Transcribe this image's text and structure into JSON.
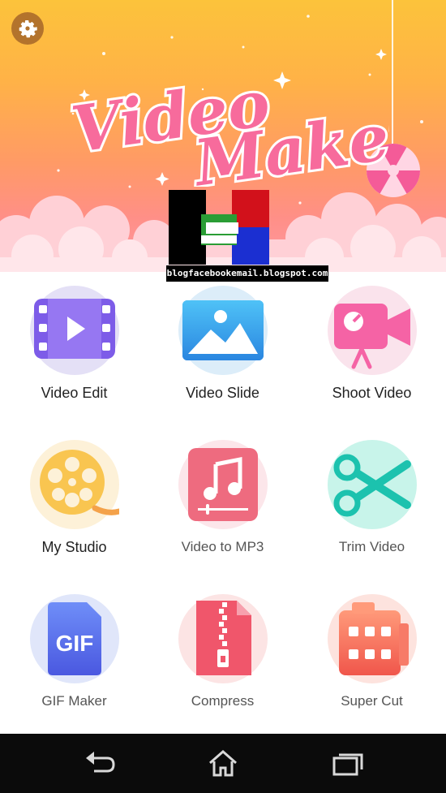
{
  "app": {
    "title_line1": "Video",
    "title_line2": "Maker",
    "watermark": "blogfacebookemail.blogspot.com"
  },
  "header": {
    "settings_icon": "gear-icon",
    "decoration": "lollipop-icon"
  },
  "colors": {
    "header_top": "#fcc33b",
    "header_bottom": "#ff9aa3",
    "title_pink": "#f76b9c",
    "nav_bar": "#0b0b0b"
  },
  "tiles": [
    {
      "label": "Video Edit",
      "icon": "video-edit-icon"
    },
    {
      "label": "Video Slide",
      "icon": "image-icon"
    },
    {
      "label": "Shoot Video",
      "icon": "camera-icon"
    },
    {
      "label": "My Studio",
      "icon": "film-reel-icon"
    },
    {
      "label": "Video to MP3",
      "icon": "music-note-icon"
    },
    {
      "label": "Trim Video",
      "icon": "scissors-icon"
    },
    {
      "label": "GIF Maker",
      "icon": "gif-icon"
    },
    {
      "label": "Compress",
      "icon": "zip-file-icon"
    },
    {
      "label": "Super Cut",
      "icon": "film-strip-icon"
    }
  ],
  "nav": {
    "back": "back-icon",
    "home": "home-icon",
    "recents": "recents-icon"
  }
}
